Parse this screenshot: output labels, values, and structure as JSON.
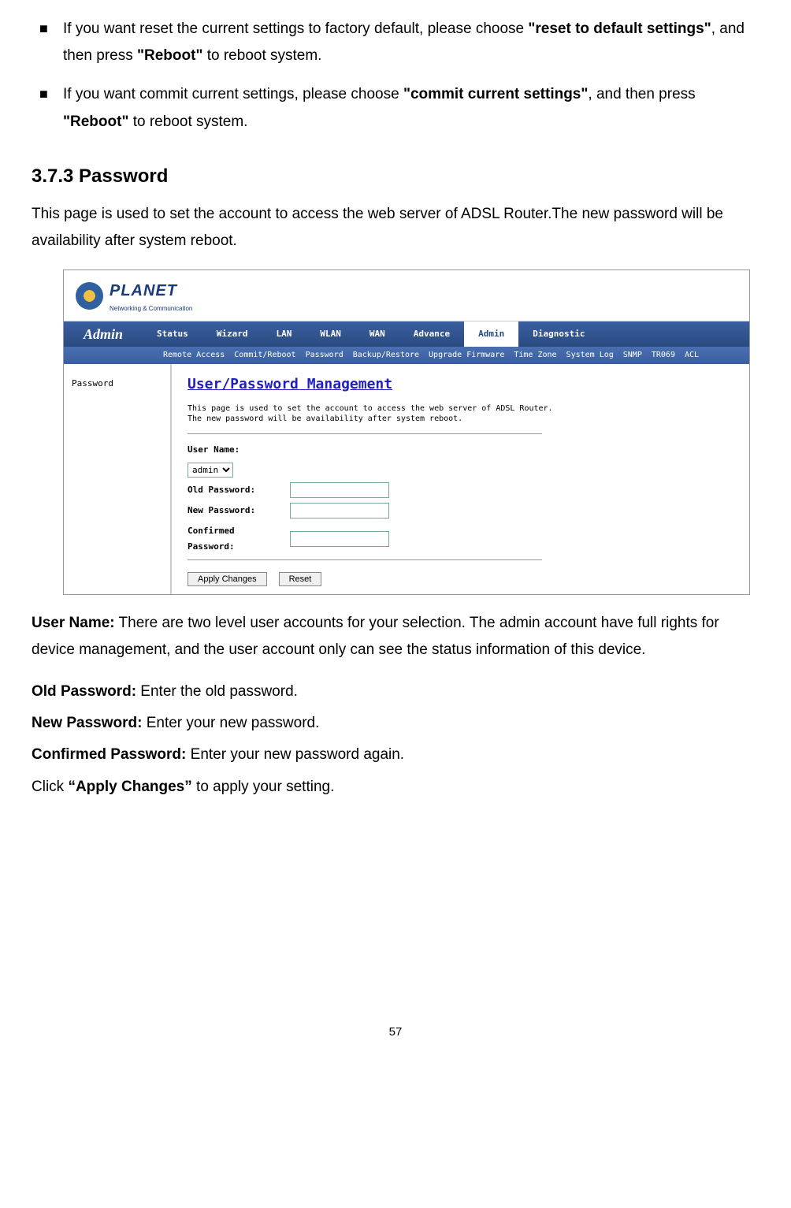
{
  "bullets": [
    {
      "prefix": "If you want reset the current settings to factory default, please choose ",
      "bold1": "\"reset to default settings\"",
      "mid": ", and then press ",
      "bold2": "\"Reboot\"",
      "suffix": " to reboot system."
    },
    {
      "prefix": "If you want commit current settings, please choose ",
      "bold1": "\"commit current settings\"",
      "mid": ", and then press ",
      "bold2": "\"Reboot\"",
      "suffix": " to reboot system."
    }
  ],
  "section": {
    "heading": "3.7.3 Password",
    "intro": "This page is used to set the account to access the web server of ADSL Router.The new password will be availability after system reboot."
  },
  "screenshot": {
    "logo": {
      "name": "PLANET",
      "sub": "Networking & Communication"
    },
    "nav": {
      "label": "Admin",
      "items": [
        "Status",
        "Wizard",
        "LAN",
        "WLAN",
        "WAN",
        "Advance",
        "Admin",
        "Diagnostic"
      ],
      "active": "Admin"
    },
    "subnav": [
      "Remote Access",
      "Commit/Reboot",
      "Password",
      "Backup/Restore",
      "Upgrade Firmware",
      "Time Zone",
      "System Log",
      "SNMP",
      "TR069",
      "ACL"
    ],
    "sidebar": {
      "item": "Password"
    },
    "panel": {
      "title": "User/Password Management",
      "desc1": "This page is used to set the account to access the web server of ADSL Router.",
      "desc2": "The new password will be availability after system reboot.",
      "userNameLabel": "User Name:",
      "userNameValue": "admin",
      "oldPwdLabel": "Old Password:",
      "newPwdLabel": "New Password:",
      "confPwdLabel1": "Confirmed",
      "confPwdLabel2": "Password:",
      "applyBtn": "Apply Changes",
      "resetBtn": "Reset"
    }
  },
  "definitions": {
    "userName": {
      "label": "User Name:",
      "text": " There are two level user accounts for your selection. The admin account have full rights for device management, and the user account only can see the status information of this device."
    },
    "oldPwd": {
      "label": "Old Password:",
      "text": " Enter the old password."
    },
    "newPwd": {
      "label": "New Password:",
      "text": " Enter your new password."
    },
    "confPwd": {
      "label": "Confirmed Password:",
      "text": " Enter your new password again."
    },
    "apply": {
      "prefix": "Click ",
      "bold": "“Apply Changes”",
      "suffix": " to apply your setting."
    }
  },
  "pageNumber": "57"
}
